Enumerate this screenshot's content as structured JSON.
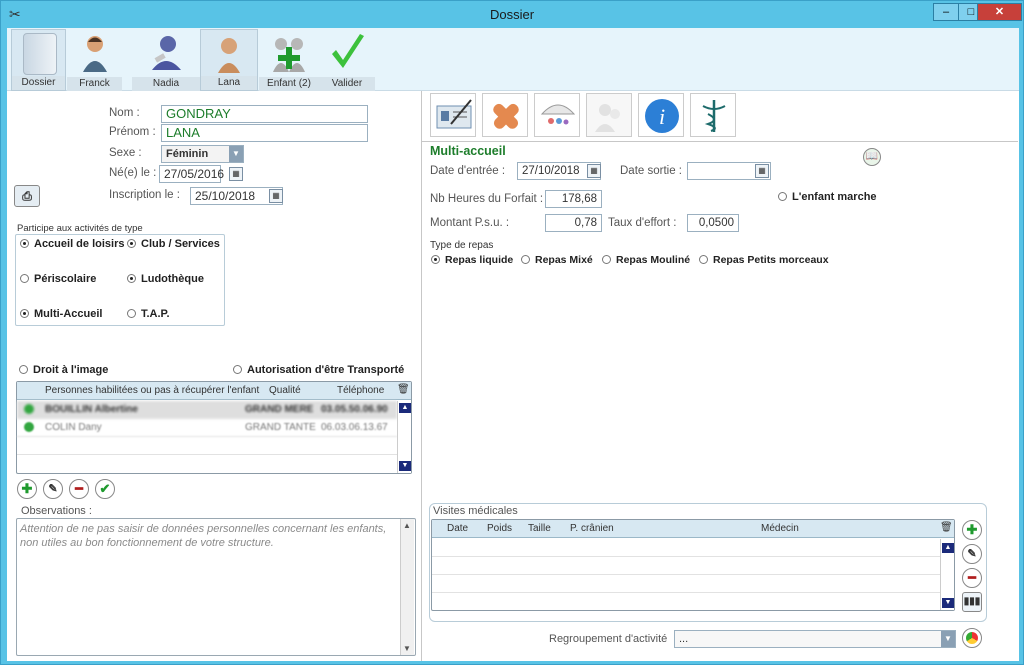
{
  "window": {
    "title": "Dossier",
    "minimize": "‒",
    "maximize": "□",
    "close": "✕"
  },
  "toolbar": [
    {
      "label": "Dossier",
      "icon": "folder-icon"
    },
    {
      "label": "Franck",
      "icon": "father-icon"
    },
    {
      "label": "Nadia",
      "icon": "mother-icon"
    },
    {
      "label": "Lana",
      "icon": "child-icon"
    },
    {
      "label": "Enfant (2)",
      "icon": "add-child-icon"
    },
    {
      "label": "Valider",
      "icon": "checkmark-icon"
    }
  ],
  "identity": {
    "nom_label": "Nom :",
    "nom": "GONDRAY",
    "prenom_label": "Prénom :",
    "prenom": "LANA",
    "sexe_label": "Sexe :",
    "sexe": "Féminin",
    "naissance_label": "Né(e) le :",
    "naissance": "27/05/2016",
    "inscription_label": "Inscription le :",
    "inscription": "25/10/2018"
  },
  "activities": {
    "title": "Participe aux activités de type",
    "items": [
      "Accueil de loisirs",
      "Club / Services",
      "Périscolaire",
      "Ludothèque",
      "Multi-Accueil",
      "T.A.P."
    ]
  },
  "permissions": {
    "droit_image": "Droit à l'image",
    "transport": "Autorisation d'être Transporté"
  },
  "persons": {
    "headers": [
      "Personnes habilitées ou pas à récupérer l'enfant",
      "Qualité",
      "Téléphone"
    ],
    "rows": [
      {
        "name": "BOUILLIN Albertine",
        "qualite": "GRAND MERE",
        "tel": "03.05.50.06.90"
      },
      {
        "name": "COLIN Dany",
        "qualite": "GRAND TANTE",
        "tel": "06.03.06.13.67"
      }
    ]
  },
  "observations": {
    "label": "Observations :",
    "text": "Attention de ne pas saisir de données personnelles concernant les enfants, non utiles au bon fonctionnement de votre structure."
  },
  "multi": {
    "title": "Multi-accueil",
    "entree_label": "Date d'entrée :",
    "entree": "27/10/2018",
    "sortie_label": "Date sortie :",
    "sortie": "",
    "heures_label": "Nb Heures du Forfait :",
    "heures": "178,68",
    "marche": "L'enfant marche",
    "psu_label": "Montant P.s.u. :",
    "psu": "0,78",
    "effort_label": "Taux d'effort :",
    "effort": "0,0500",
    "repas_title": "Type de repas",
    "repas": [
      "Repas liquide",
      "Repas Mixé",
      "Repas Mouliné",
      "Repas Petits morceaux"
    ]
  },
  "visites": {
    "title": "Visites médicales",
    "headers": [
      "Date",
      "Poids",
      "Taille",
      "P. crânien",
      "Médecin"
    ]
  },
  "regroupement": {
    "label": "Regroupement d'activité",
    "value": "..."
  }
}
